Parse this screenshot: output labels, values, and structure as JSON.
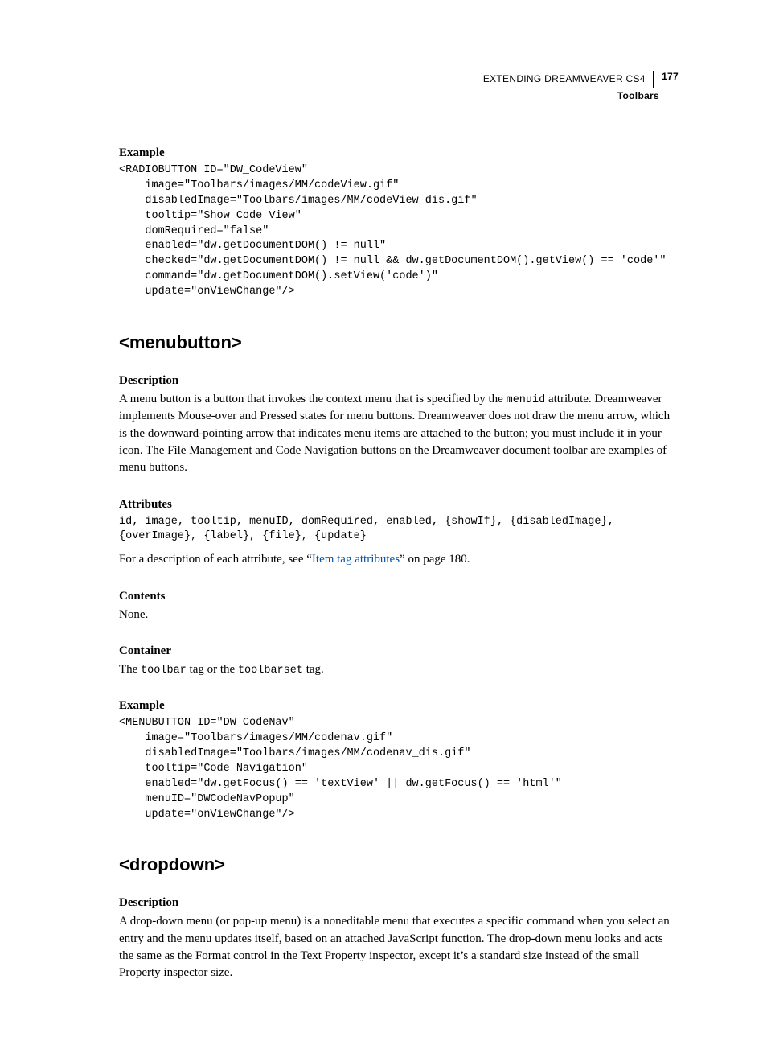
{
  "header": {
    "title": "EXTENDING DREAMWEAVER CS4",
    "page_num": "177",
    "section": "Toolbars"
  },
  "sections": {
    "example1": {
      "label": "Example",
      "code": "<RADIOBUTTON ID=\"DW_CodeView\"\n    image=\"Toolbars/images/MM/codeView.gif\"\n    disabledImage=\"Toolbars/images/MM/codeView_dis.gif\"\n    tooltip=\"Show Code View\"\n    domRequired=\"false\"\n    enabled=\"dw.getDocumentDOM() != null\"\n    checked=\"dw.getDocumentDOM() != null && dw.getDocumentDOM().getView() == 'code'\"\n    command=\"dw.getDocumentDOM().setView('code')\"\n    update=\"onViewChange\"/>"
    },
    "menubutton": {
      "heading": "<menubutton>",
      "desc_label": "Description",
      "desc_pre": "A menu button is a button that invokes the context menu that is specified by the ",
      "desc_code": "menuid",
      "desc_post": " attribute. Dreamweaver implements Mouse-over and Pressed states for menu buttons. Dreamweaver does not draw the menu arrow, which is the downward-pointing arrow that indicates menu items are attached to the button; you must include it in your icon. The File Management and Code Navigation buttons on the Dreamweaver document toolbar are examples of menu buttons.",
      "attrs_label": "Attributes",
      "attrs_code": "id, image, tooltip, menuID, domRequired, enabled, {showIf}, {disabledImage}, {overImage}, {label}, {file}, {update}",
      "attrs_desc_pre": "For a description of each attribute, see “",
      "attrs_link": "Item tag attributes",
      "attrs_desc_post": "” on page 180.",
      "contents_label": "Contents",
      "contents_text": "None.",
      "container_label": "Container",
      "container_pre": "The ",
      "container_code1": "toolbar",
      "container_mid": " tag or the ",
      "container_code2": "toolbarset",
      "container_post": " tag.",
      "example_label": "Example",
      "example_code": "<MENUBUTTON ID=\"DW_CodeNav\"\n    image=\"Toolbars/images/MM/codenav.gif\"\n    disabledImage=\"Toolbars/images/MM/codenav_dis.gif\"\n    tooltip=\"Code Navigation\"\n    enabled=\"dw.getFocus() == 'textView' || dw.getFocus() == 'html'\"\n    menuID=\"DWCodeNavPopup\"\n    update=\"onViewChange\"/>"
    },
    "dropdown": {
      "heading": "<dropdown>",
      "desc_label": "Description",
      "desc_text": "A drop-down menu (or pop-up menu) is a noneditable menu that executes a specific command when you select an entry and the menu updates itself, based on an attached JavaScript function. The drop-down menu looks and acts the same as the Format control in the Text Property inspector, except it’s a standard size instead of the small Property inspector size."
    }
  }
}
